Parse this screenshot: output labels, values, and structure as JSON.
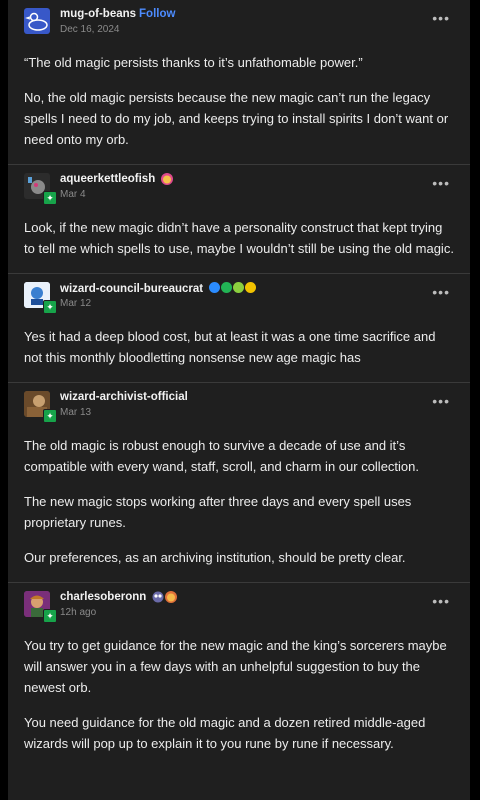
{
  "follow_label": "Follow",
  "menu_glyph": "•••",
  "posts": [
    {
      "username": "mug-of-beans",
      "date": "Dec 16, 2024",
      "paragraphs": [
        "“The old magic persists thanks to it’s unfathomable power.”",
        "No, the old magic persists because the new magic can’t run the legacy spells I need to do my job, and keeps trying to install spirits I don’t want or need onto my orb."
      ]
    },
    {
      "username": "aqueerkettleofish",
      "date": "Mar 4",
      "paragraphs": [
        "Look, if the new magic didn’t have a personality construct that kept trying to tell me which spells to use, maybe I wouldn’t still be using the old magic."
      ]
    },
    {
      "username": "wizard-council-bureaucrat",
      "date": "Mar 12",
      "paragraphs": [
        "Yes it had a deep blood cost, but at least it was a one time sacrifice and not this monthly bloodletting nonsense new age magic has"
      ]
    },
    {
      "username": "wizard-archivist-official",
      "date": "Mar 13",
      "paragraphs": [
        "The old magic is robust enough to survive a decade of use and it’s compatible with every wand, staff, scroll, and charm in our collection.",
        "The new magic stops working after three days and every spell uses proprietary runes.",
        "Our preferences, as an archiving institution, should be pretty clear."
      ]
    },
    {
      "username": "charlesoberonn",
      "date": "12h ago",
      "paragraphs": [
        "You try to get guidance for the new magic and the king’s sorcerers maybe will answer you in a few days with an unhelpful suggestion to buy the newest orb.",
        "You need guidance for the old magic and a dozen retired middle-aged wizards will pop up to explain it to you rune by rune if necessary."
      ]
    }
  ],
  "colors": {
    "background": "#1f1f1f",
    "follow": "#4d8cff",
    "badge": "#17a34a",
    "check_blue": "#2b8cff",
    "check_green": "#22b455",
    "check_yellow": "#f2c200"
  },
  "icons": [
    "more-options-icon",
    "community-badge-icon",
    "verified-check-icon",
    "face-emoji-icon"
  ]
}
